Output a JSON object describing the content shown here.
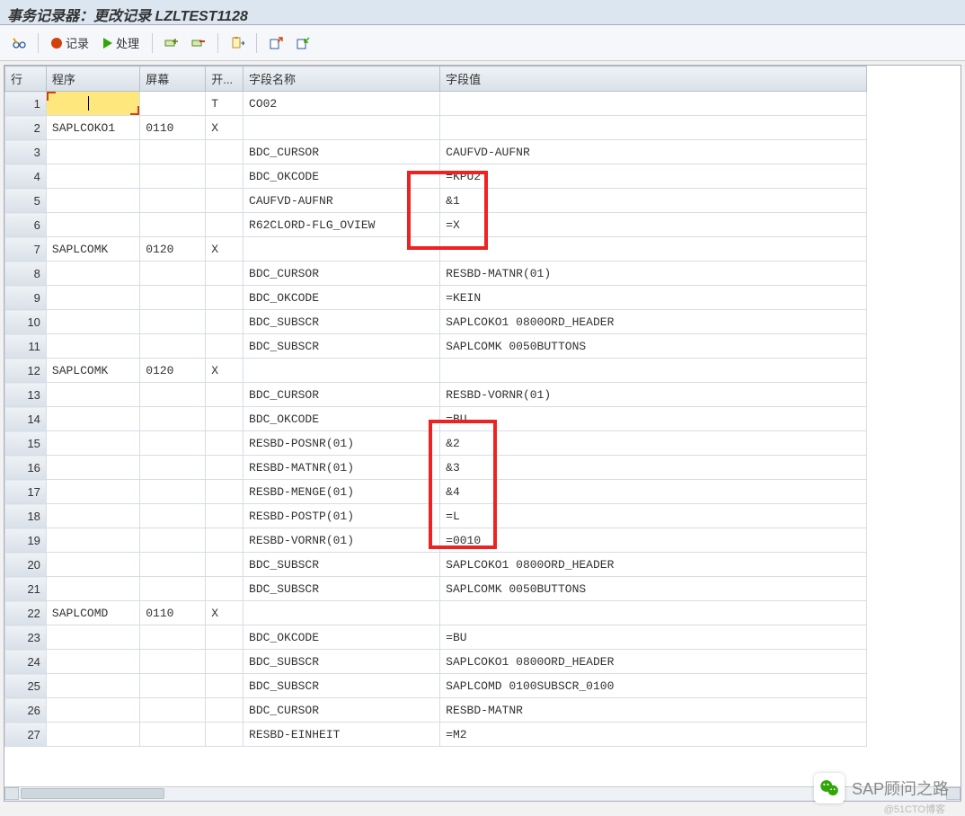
{
  "title": "事务记录器：更改记录 LZLTEST1128",
  "toolbar": {
    "record_label": "记录",
    "process_label": "处理"
  },
  "columns": {
    "row": "行",
    "program": "程序",
    "screen": "屏幕",
    "start": "开...",
    "field_name": "字段名称",
    "field_value": "字段值"
  },
  "rows": [
    {
      "n": 1,
      "program": "",
      "screen": "",
      "start": "T",
      "fname": "CO02",
      "fval": "",
      "red": true,
      "edit": true
    },
    {
      "n": 2,
      "program": "SAPLCOKO1",
      "screen": "0110",
      "start": "X",
      "fname": "",
      "fval": "",
      "red": true
    },
    {
      "n": 3,
      "program": "",
      "screen": "",
      "start": "",
      "fname": "BDC_CURSOR",
      "fval": "CAUFVD-AUFNR"
    },
    {
      "n": 4,
      "program": "",
      "screen": "",
      "start": "",
      "fname": "BDC_OKCODE",
      "fval": "=KPU2"
    },
    {
      "n": 5,
      "program": "",
      "screen": "",
      "start": "",
      "fname": "CAUFVD-AUFNR",
      "fval": "&1"
    },
    {
      "n": 6,
      "program": "",
      "screen": "",
      "start": "",
      "fname": "R62CLORD-FLG_OVIEW",
      "fval": "=X"
    },
    {
      "n": 7,
      "program": "SAPLCOMK",
      "screen": "0120",
      "start": "X",
      "fname": "",
      "fval": "",
      "red": true
    },
    {
      "n": 8,
      "program": "",
      "screen": "",
      "start": "",
      "fname": "BDC_CURSOR",
      "fval": "RESBD-MATNR(01)"
    },
    {
      "n": 9,
      "program": "",
      "screen": "",
      "start": "",
      "fname": "BDC_OKCODE",
      "fval": "=KEIN"
    },
    {
      "n": 10,
      "program": "",
      "screen": "",
      "start": "",
      "fname": "BDC_SUBSCR",
      "fval": "SAPLCOKO1                              0800ORD_HEADER"
    },
    {
      "n": 11,
      "program": "",
      "screen": "",
      "start": "",
      "fname": "BDC_SUBSCR",
      "fval": "SAPLCOMK                               0050BUTTONS"
    },
    {
      "n": 12,
      "program": "SAPLCOMK",
      "screen": "0120",
      "start": "X",
      "fname": "",
      "fval": "",
      "red": true
    },
    {
      "n": 13,
      "program": "",
      "screen": "",
      "start": "",
      "fname": "BDC_CURSOR",
      "fval": "RESBD-VORNR(01)"
    },
    {
      "n": 14,
      "program": "",
      "screen": "",
      "start": "",
      "fname": "BDC_OKCODE",
      "fval": "=BU"
    },
    {
      "n": 15,
      "program": "",
      "screen": "",
      "start": "",
      "fname": "RESBD-POSNR(01)",
      "fval": "&2"
    },
    {
      "n": 16,
      "program": "",
      "screen": "",
      "start": "",
      "fname": "RESBD-MATNR(01)",
      "fval": "&3"
    },
    {
      "n": 17,
      "program": "",
      "screen": "",
      "start": "",
      "fname": "RESBD-MENGE(01)",
      "fval": "&4"
    },
    {
      "n": 18,
      "program": "",
      "screen": "",
      "start": "",
      "fname": "RESBD-POSTP(01)",
      "fval": "=L"
    },
    {
      "n": 19,
      "program": "",
      "screen": "",
      "start": "",
      "fname": "RESBD-VORNR(01)",
      "fval": "=0010"
    },
    {
      "n": 20,
      "program": "",
      "screen": "",
      "start": "",
      "fname": "BDC_SUBSCR",
      "fval": "SAPLCOKO1                              0800ORD_HEADER"
    },
    {
      "n": 21,
      "program": "",
      "screen": "",
      "start": "",
      "fname": "BDC_SUBSCR",
      "fval": "SAPLCOMK                               0050BUTTONS"
    },
    {
      "n": 22,
      "program": "SAPLCOMD",
      "screen": "0110",
      "start": "X",
      "fname": "",
      "fval": "",
      "red": true
    },
    {
      "n": 23,
      "program": "",
      "screen": "",
      "start": "",
      "fname": "BDC_OKCODE",
      "fval": "=BU"
    },
    {
      "n": 24,
      "program": "",
      "screen": "",
      "start": "",
      "fname": "BDC_SUBSCR",
      "fval": "SAPLCOKO1                              0800ORD_HEADER"
    },
    {
      "n": 25,
      "program": "",
      "screen": "",
      "start": "",
      "fname": "BDC_SUBSCR",
      "fval": "SAPLCOMD                               0100SUBSCR_0100"
    },
    {
      "n": 26,
      "program": "",
      "screen": "",
      "start": "",
      "fname": "BDC_CURSOR",
      "fval": "RESBD-MATNR"
    },
    {
      "n": 27,
      "program": "",
      "screen": "",
      "start": "",
      "fname": "RESBD-EINHEIT",
      "fval": "=M2"
    }
  ],
  "watermark": {
    "brand": "SAP顾问之路",
    "small": "@51CTO博客"
  }
}
